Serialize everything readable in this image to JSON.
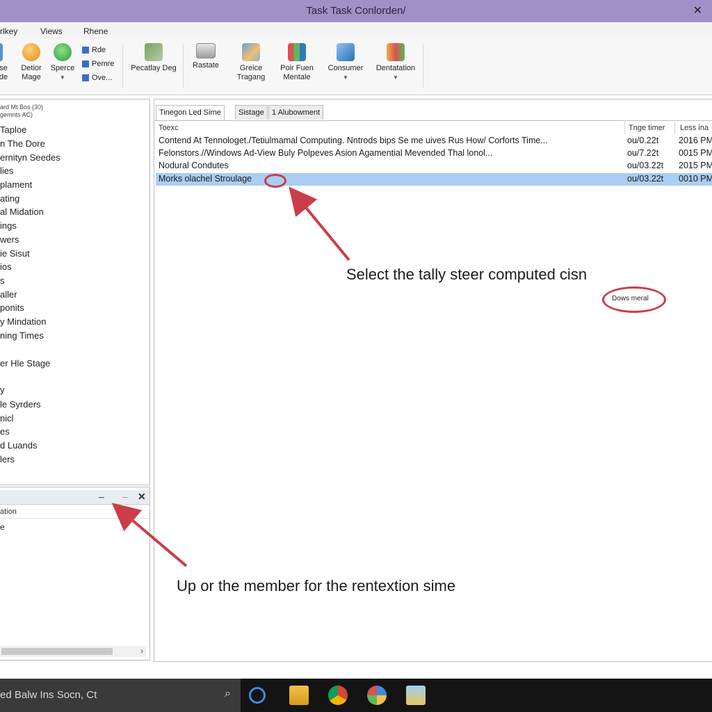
{
  "window": {
    "title": "Task Task Conlorden/"
  },
  "menu": [
    "rlkey",
    "Views",
    "Rhene"
  ],
  "ribbon": {
    "buttons": [
      {
        "label1": "se",
        "label2": "de",
        "icon": "partial-icon"
      },
      {
        "label1": "Detior",
        "label2": "Mage",
        "icon": "orange-sphere-icon"
      },
      {
        "label1": "Sperce",
        "label2": "",
        "icon": "green-plus-icon"
      },
      {
        "label1": "Pecatlay Deg",
        "label2": "",
        "icon": "screens-icon"
      },
      {
        "label1": "Rastate",
        "label2": "",
        "icon": "monitor-icon"
      },
      {
        "label1": "Greice",
        "label2": "Tragang",
        "icon": "chart-window-icon"
      },
      {
        "label1": "Poir Fuen",
        "label2": "Mentale",
        "icon": "colored-grid-icon"
      },
      {
        "label1": "Consumer",
        "label2": "",
        "icon": "blue-cube-icon"
      },
      {
        "label1": "Dentatation",
        "label2": "",
        "icon": "gift-icon"
      }
    ],
    "small": [
      "Rde",
      "Pemre",
      "Ove..."
    ]
  },
  "left_pane": {
    "header": [
      "ard Mt Bos (30)",
      "gemnts AC)"
    ],
    "items": [
      "Taploe",
      "n The Dore",
      "ernityn Seedes",
      "lies",
      "plament",
      "ating",
      "al Midation",
      "ings",
      "wers",
      "ie Sisut",
      "ios",
      "s",
      "aller",
      "ponits",
      "y Mindation",
      "ning Times",
      "",
      "er Hle Stage",
      "",
      "y",
      "le Syrders",
      "nicl",
      "es",
      "d Luands",
      "lers"
    ]
  },
  "bottom_pane": {
    "column": "ation",
    "row": "e",
    "controls": [
      "–",
      "–",
      "✕"
    ]
  },
  "main": {
    "tabs": [
      "Tinegon Led Sime",
      "Sistage",
      "1 Alubowment"
    ],
    "columns": [
      "Toexc",
      "Tnge timer",
      "Less ina"
    ],
    "rows": [
      {
        "name": "Contend At Tennologet./Tetiulmamal Computing. Nntrods bips Se me uives Rus How/ Corforts Time...",
        "time": "ou/0.22t",
        "less": "2016 PM",
        "selected": false
      },
      {
        "name": "Felonstors.//Windows Ad-View Buly Polpeves Asion Agamential Mevended Thal lonol...",
        "time": "ou/7.22t",
        "less": "0015 PM",
        "selected": false
      },
      {
        "name": "Nodural Condutes",
        "time": "ou/03.22t",
        "less": "2015 PM",
        "selected": false
      },
      {
        "name": "Morks olachel Stroulage",
        "time": "ou/03.22t",
        "less": "0010 PM",
        "selected": true
      }
    ],
    "annotation_top": "Select the tally steer computed cisn",
    "annotation_button": "Dows meral",
    "annotation_bottom": "Up or the member for the rentextion sime"
  },
  "taskbar": {
    "search_text": "ed Balw Ins Socn, Ct",
    "icons": [
      "cortana-icon",
      "file-explorer-icon",
      "chrome-icon",
      "colorful-ball-icon",
      "folder-icon"
    ]
  },
  "colors": {
    "titlebar": "#a18fc7",
    "selection": "#aacdf1",
    "annotation_red": "#cc3d4a",
    "taskbar": "#141414"
  }
}
